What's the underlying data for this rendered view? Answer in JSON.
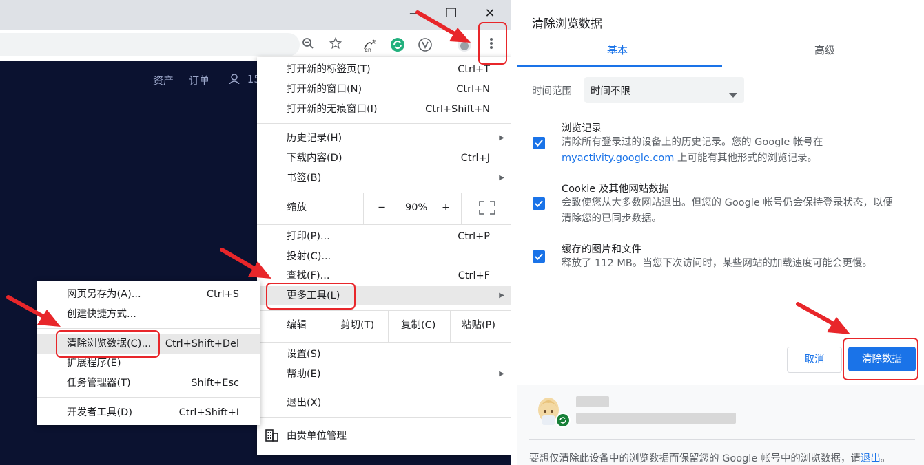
{
  "browser": {
    "window": {
      "minimize": "—",
      "restore": "❐",
      "close": "✕"
    },
    "site_nav": {
      "assets": "资产",
      "orders": "订单",
      "user_partial": "15"
    }
  },
  "main_menu": {
    "new_tab": {
      "label": "打开新的标签页(T)",
      "shortcut": "Ctrl+T"
    },
    "new_window": {
      "label": "打开新的窗口(N)",
      "shortcut": "Ctrl+N"
    },
    "new_incognito": {
      "label": "打开新的无痕窗口(I)",
      "shortcut": "Ctrl+Shift+N"
    },
    "history": {
      "label": "历史记录(H)"
    },
    "downloads": {
      "label": "下载内容(D)",
      "shortcut": "Ctrl+J"
    },
    "bookmarks": {
      "label": "书签(B)"
    },
    "zoom": {
      "label": "缩放",
      "minus": "−",
      "value": "90%",
      "plus": "+"
    },
    "print": {
      "label": "打印(P)...",
      "shortcut": "Ctrl+P"
    },
    "cast": {
      "label": "投射(C)..."
    },
    "find": {
      "label": "查找(F)...",
      "shortcut": "Ctrl+F"
    },
    "more_tools": {
      "label": "更多工具(L)"
    },
    "edit": {
      "label": "编辑",
      "cut": "剪切(T)",
      "copy": "复制(C)",
      "paste": "粘贴(P)"
    },
    "settings": {
      "label": "设置(S)"
    },
    "help": {
      "label": "帮助(E)"
    },
    "exit": {
      "label": "退出(X)"
    },
    "managed": {
      "label": "由贵单位管理"
    }
  },
  "submenu": {
    "save_page": {
      "label": "网页另存为(A)...",
      "shortcut": "Ctrl+S"
    },
    "create_shortcut": {
      "label": "创建快捷方式..."
    },
    "clear_data": {
      "label": "清除浏览数据(C)...",
      "shortcut": "Ctrl+Shift+Del"
    },
    "extensions": {
      "label": "扩展程序(E)"
    },
    "task_manager": {
      "label": "任务管理器(T)",
      "shortcut": "Shift+Esc"
    },
    "dev_tools": {
      "label": "开发者工具(D)",
      "shortcut": "Ctrl+Shift+I"
    }
  },
  "dialog": {
    "title": "清除浏览数据",
    "tabs": {
      "basic": "基本",
      "advanced": "高级"
    },
    "time_range_label": "时间范围",
    "time_range_value": "时间不限",
    "items": [
      {
        "title": "浏览记录",
        "desc1": "清除所有登录过的设备上的历史记录。您的 Google 帐号在",
        "link": "myactivity.google.com",
        "desc2": " 上可能有其他形式的浏览记录。",
        "checked": true
      },
      {
        "title": "Cookie 及其他网站数据",
        "desc1": "会致使您从大多数网站退出。但您的 Google 帐号仍会保持登录状态，以便",
        "desc2": "清除您的已同步数据。",
        "checked": true
      },
      {
        "title": "缓存的图片和文件",
        "desc1": "释放了 112 MB。当您下次访问时，某些网站的加载速度可能会更慢。",
        "checked": true
      }
    ],
    "cancel_label": "取消",
    "clear_label": "清除数据",
    "footer_text": "要想仅清除此设备中的浏览数据而保留您的 Google 帐号中的浏览数据，请",
    "footer_link": "退出",
    "footer_end": "。"
  },
  "colors": {
    "accent": "#1a73e8",
    "highlight": "#e8262a",
    "page_bg": "#0b1230"
  }
}
